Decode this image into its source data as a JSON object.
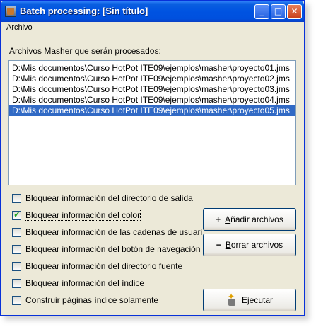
{
  "window": {
    "title": "Batch processing: [Sin título]",
    "controls": {
      "minimize": "_",
      "maximize": "□",
      "close": "✕"
    }
  },
  "menubar": {
    "items": [
      "Archivo"
    ]
  },
  "files_section": {
    "label": "Archivos Masher que serán procesados:",
    "items": [
      "D:\\Mis documentos\\Curso HotPot ITE09\\ejemplos\\masher\\proyecto01.jms",
      "D:\\Mis documentos\\Curso HotPot ITE09\\ejemplos\\masher\\proyecto02.jms",
      "D:\\Mis documentos\\Curso HotPot ITE09\\ejemplos\\masher\\proyecto03.jms",
      "D:\\Mis documentos\\Curso HotPot ITE09\\ejemplos\\masher\\proyecto04.jms",
      "D:\\Mis documentos\\Curso HotPot ITE09\\ejemplos\\masher\\proyecto05.jms"
    ],
    "selected_index": 4
  },
  "options": [
    {
      "label": "Bloquear información del directorio de salida",
      "checked": false
    },
    {
      "label": "Bloquear información del color",
      "checked": true
    },
    {
      "label": "Bloquear información de las cadenas de usuario",
      "checked": false
    },
    {
      "label": "Bloquear información del botón de navegación",
      "checked": false
    },
    {
      "label": "Bloquear información del directorio fuente",
      "checked": false
    },
    {
      "label": "Bloquear información del índice",
      "checked": false
    },
    {
      "label": "Construir páginas índice solamente",
      "checked": false
    }
  ],
  "buttons": {
    "add": {
      "icon": "plus-icon",
      "glyph": "+",
      "mnemonic": "A",
      "rest": "ñadir archivos"
    },
    "remove": {
      "icon": "minus-icon",
      "glyph": "−",
      "mnemonic": "B",
      "rest": "orrar archivos"
    },
    "run": {
      "icon": "execute-icon",
      "mnemonic": "E",
      "rest": "jecutar"
    }
  },
  "colors": {
    "titlebar": "#0053e1",
    "selection": "#316ac5",
    "window_bg": "#ece9d8"
  }
}
